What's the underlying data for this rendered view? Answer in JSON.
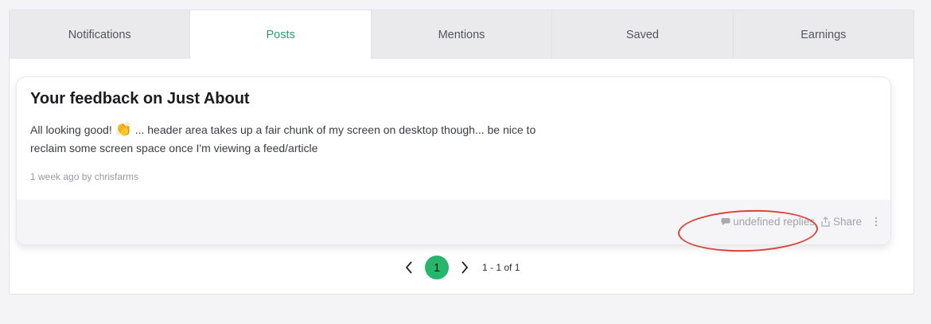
{
  "tabs": [
    {
      "label": "Notifications",
      "active": false
    },
    {
      "label": "Posts",
      "active": true
    },
    {
      "label": "Mentions",
      "active": false
    },
    {
      "label": "Saved",
      "active": false
    },
    {
      "label": "Earnings",
      "active": false
    }
  ],
  "post": {
    "title": "Your feedback on Just About",
    "body_before_emoji": "All looking good!",
    "emoji": "👏",
    "body_after_emoji": "... header area takes up a fair chunk of my screen on desktop though... be nice to reclaim some screen space once I'm viewing a feed/article",
    "meta": "1 week ago by chrisfarms",
    "replies_label": "undefined replies",
    "share_label": "Share",
    "icons": {
      "replies": "comment-icon",
      "share": "share-icon",
      "more": "more-vertical-icon"
    }
  },
  "pagination": {
    "current_page": "1",
    "range_label": "1 - 1 of 1",
    "icons": {
      "prev": "chevron-left-icon",
      "next": "chevron-right-icon"
    }
  },
  "colors": {
    "accent": "#27b56c",
    "active_tab_text": "#2e9e6a",
    "annotation": "#d9433a"
  }
}
